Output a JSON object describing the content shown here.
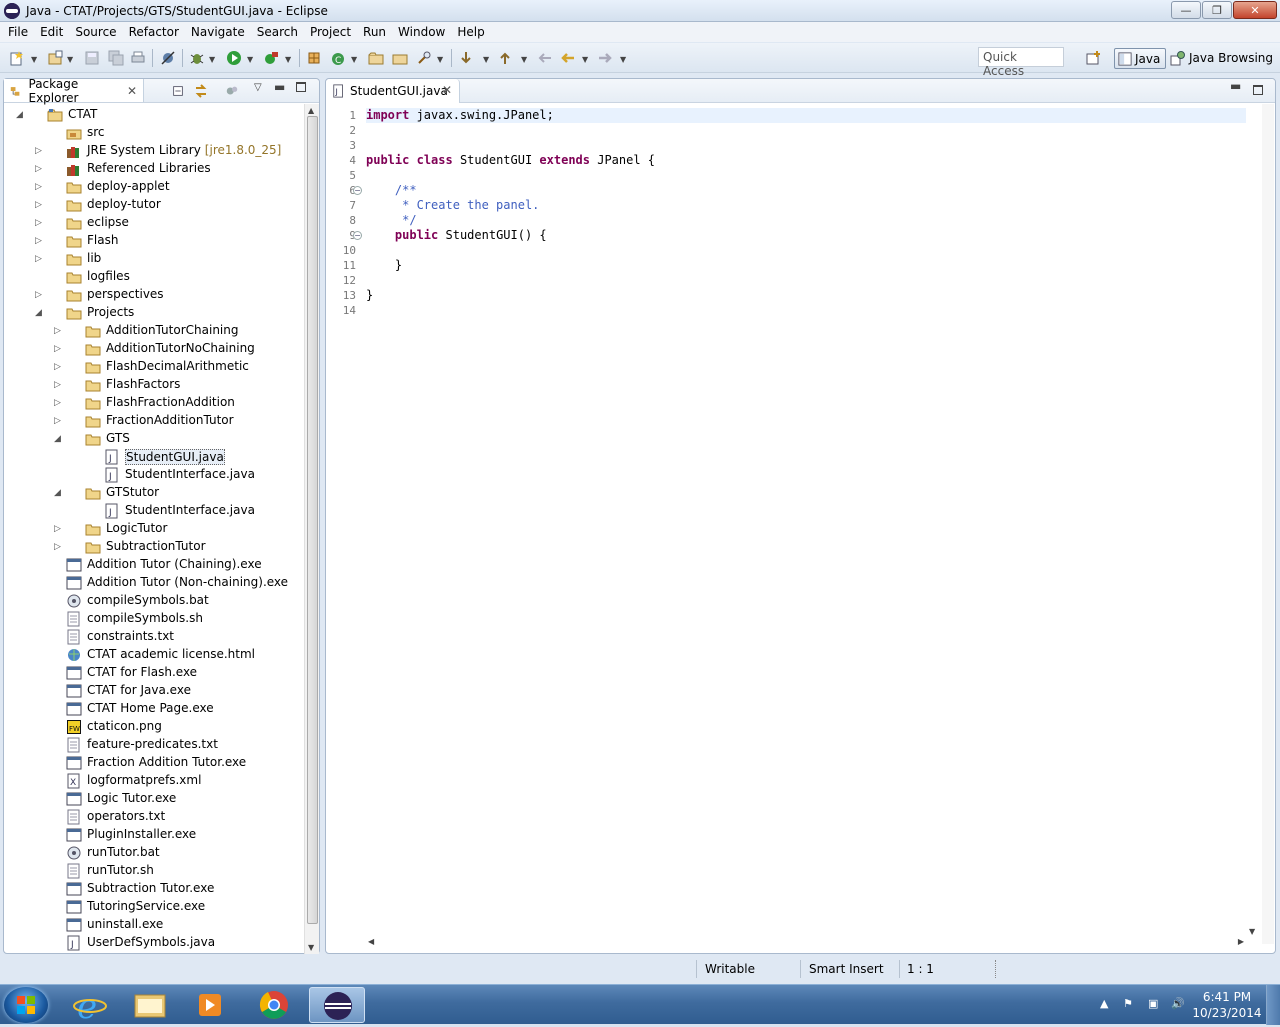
{
  "window": {
    "title": "Java - CTAT/Projects/GTS/StudentGUI.java - Eclipse"
  },
  "menu": [
    "File",
    "Edit",
    "Source",
    "Refactor",
    "Navigate",
    "Search",
    "Project",
    "Run",
    "Window",
    "Help"
  ],
  "toolbar": {
    "quick_access_placeholder": "Quick Access"
  },
  "perspectives": {
    "java": "Java",
    "java_browsing": "Java Browsing"
  },
  "package_explorer": {
    "tab_label": "Package Explorer",
    "rows": [
      {
        "label": "CTAT",
        "level": 0,
        "expand": "open",
        "icon": "project-icon"
      },
      {
        "label": "src",
        "level": 1,
        "expand": "none",
        "icon": "package-folder-icon"
      },
      {
        "label": "JRE System Library",
        "deco": "[jre1.8.0_25]",
        "level": 1,
        "expand": "closed",
        "icon": "library-icon"
      },
      {
        "label": "Referenced Libraries",
        "level": 1,
        "expand": "closed",
        "icon": "library-icon"
      },
      {
        "label": "deploy-applet",
        "level": 1,
        "expand": "closed",
        "icon": "folder-icon"
      },
      {
        "label": "deploy-tutor",
        "level": 1,
        "expand": "closed",
        "icon": "folder-icon"
      },
      {
        "label": "eclipse",
        "level": 1,
        "expand": "closed",
        "icon": "folder-icon"
      },
      {
        "label": "Flash",
        "level": 1,
        "expand": "closed",
        "icon": "folder-icon"
      },
      {
        "label": "lib",
        "level": 1,
        "expand": "closed",
        "icon": "folder-icon"
      },
      {
        "label": "logfiles",
        "level": 1,
        "expand": "none",
        "icon": "folder-icon"
      },
      {
        "label": "perspectives",
        "level": 1,
        "expand": "closed",
        "icon": "folder-icon"
      },
      {
        "label": "Projects",
        "level": 1,
        "expand": "open",
        "icon": "folder-icon"
      },
      {
        "label": "AdditionTutorChaining",
        "level": 2,
        "expand": "closed",
        "icon": "folder-icon"
      },
      {
        "label": "AdditionTutorNoChaining",
        "level": 2,
        "expand": "closed",
        "icon": "folder-icon"
      },
      {
        "label": "FlashDecimalArithmetic",
        "level": 2,
        "expand": "closed",
        "icon": "folder-icon"
      },
      {
        "label": "FlashFactors",
        "level": 2,
        "expand": "closed",
        "icon": "folder-icon"
      },
      {
        "label": "FlashFractionAddition",
        "level": 2,
        "expand": "closed",
        "icon": "folder-icon"
      },
      {
        "label": "FractionAdditionTutor",
        "level": 2,
        "expand": "closed",
        "icon": "folder-icon"
      },
      {
        "label": "GTS",
        "level": 2,
        "expand": "open",
        "icon": "folder-icon"
      },
      {
        "label": "StudentGUI.java",
        "level": 3,
        "expand": "none",
        "icon": "java-file-icon",
        "selected": true
      },
      {
        "label": "StudentInterface.java",
        "level": 3,
        "expand": "none",
        "icon": "java-file-icon"
      },
      {
        "label": "GTStutor",
        "level": 2,
        "expand": "open",
        "icon": "folder-icon"
      },
      {
        "label": "StudentInterface.java",
        "level": 3,
        "expand": "none",
        "icon": "java-file-icon"
      },
      {
        "label": "LogicTutor",
        "level": 2,
        "expand": "closed",
        "icon": "folder-icon"
      },
      {
        "label": "SubtractionTutor",
        "level": 2,
        "expand": "closed",
        "icon": "folder-icon"
      },
      {
        "label": "Addition Tutor (Chaining).exe",
        "level": 1,
        "expand": "none",
        "icon": "exe-file-icon"
      },
      {
        "label": "Addition Tutor (Non-chaining).exe",
        "level": 1,
        "expand": "none",
        "icon": "exe-file-icon"
      },
      {
        "label": "compileSymbols.bat",
        "level": 1,
        "expand": "none",
        "icon": "bat-file-icon"
      },
      {
        "label": "compileSymbols.sh",
        "level": 1,
        "expand": "none",
        "icon": "text-file-icon"
      },
      {
        "label": "constraints.txt",
        "level": 1,
        "expand": "none",
        "icon": "text-file-icon"
      },
      {
        "label": "CTAT academic license.html",
        "level": 1,
        "expand": "none",
        "icon": "html-file-icon"
      },
      {
        "label": "CTAT for Flash.exe",
        "level": 1,
        "expand": "none",
        "icon": "exe-file-icon"
      },
      {
        "label": "CTAT for Java.exe",
        "level": 1,
        "expand": "none",
        "icon": "exe-file-icon"
      },
      {
        "label": "CTAT Home Page.exe",
        "level": 1,
        "expand": "none",
        "icon": "exe-file-icon"
      },
      {
        "label": "ctaticon.png",
        "level": 1,
        "expand": "none",
        "icon": "image-file-icon"
      },
      {
        "label": "feature-predicates.txt",
        "level": 1,
        "expand": "none",
        "icon": "text-file-icon"
      },
      {
        "label": "Fraction Addition Tutor.exe",
        "level": 1,
        "expand": "none",
        "icon": "exe-file-icon"
      },
      {
        "label": "logformatprefs.xml",
        "level": 1,
        "expand": "none",
        "icon": "xml-file-icon"
      },
      {
        "label": "Logic Tutor.exe",
        "level": 1,
        "expand": "none",
        "icon": "exe-file-icon"
      },
      {
        "label": "operators.txt",
        "level": 1,
        "expand": "none",
        "icon": "text-file-icon"
      },
      {
        "label": "PluginInstaller.exe",
        "level": 1,
        "expand": "none",
        "icon": "exe-file-icon"
      },
      {
        "label": "runTutor.bat",
        "level": 1,
        "expand": "none",
        "icon": "bat-file-icon"
      },
      {
        "label": "runTutor.sh",
        "level": 1,
        "expand": "none",
        "icon": "text-file-icon"
      },
      {
        "label": "Subtraction Tutor.exe",
        "level": 1,
        "expand": "none",
        "icon": "exe-file-icon"
      },
      {
        "label": "TutoringService.exe",
        "level": 1,
        "expand": "none",
        "icon": "exe-file-icon"
      },
      {
        "label": "uninstall.exe",
        "level": 1,
        "expand": "none",
        "icon": "exe-file-icon"
      },
      {
        "label": "UserDefSymbols.java",
        "level": 1,
        "expand": "none",
        "icon": "java-file-icon"
      }
    ]
  },
  "editor": {
    "tab_label": "StudentGUI.java",
    "lines": [
      [
        {
          "t": "import",
          "c": "kw"
        },
        {
          "t": " javax.swing.JPanel;"
        }
      ],
      [],
      [],
      [
        {
          "t": "public",
          "c": "kw"
        },
        {
          "t": " "
        },
        {
          "t": "class",
          "c": "kw"
        },
        {
          "t": " StudentGUI "
        },
        {
          "t": "extends",
          "c": "kw"
        },
        {
          "t": " JPanel {"
        }
      ],
      [],
      [
        {
          "t": "    "
        },
        {
          "t": "/**",
          "c": "cm"
        }
      ],
      [
        {
          "t": "     * Create the panel.",
          "c": "cm"
        }
      ],
      [
        {
          "t": "     */",
          "c": "cm"
        }
      ],
      [
        {
          "t": "    "
        },
        {
          "t": "public",
          "c": "kw"
        },
        {
          "t": " StudentGUI() {"
        }
      ],
      [],
      [
        {
          "t": "    }"
        }
      ],
      [],
      [
        {
          "t": "}"
        }
      ],
      []
    ],
    "fold_lines": [
      6,
      9
    ]
  },
  "status": {
    "writable": "Writable",
    "insert_mode": "Smart Insert",
    "position": "1 : 1"
  },
  "taskbar": {
    "time": "6:41 PM",
    "date": "10/23/2014"
  }
}
